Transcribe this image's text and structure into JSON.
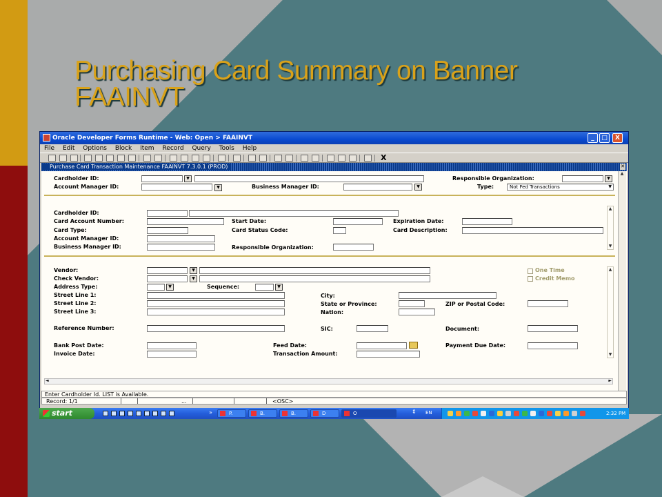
{
  "slide": {
    "title": "Purchasing Card Summary on Banner FAAINVT"
  },
  "window": {
    "title": "Oracle Developer Forms Runtime - Web:  Open > FAAINVT",
    "controls": [
      "_",
      "□",
      "X"
    ],
    "menu": [
      "File",
      "Edit",
      "Options",
      "Block",
      "Item",
      "Record",
      "Query",
      "Tools",
      "Help"
    ],
    "toolbar_exit": "X"
  },
  "form": {
    "header": "Purchase Card Transaction Maintenance  FAAINVT  7.3.0.1  (PROD)",
    "key_block": {
      "cardholder_id_label": "Cardholder ID:",
      "account_manager_id_label": "Account Manager ID:",
      "business_manager_id_label": "Business Manager ID:",
      "responsible_org_label": "Responsible Organization:",
      "type_label": "Type:",
      "type_value": "Not Fed Transactions"
    },
    "card_block": {
      "cardholder_id_label": "Cardholder ID:",
      "card_account_number_label": "Card Account Number:",
      "card_type_label": "Card Type:",
      "account_manager_id_label": "Account Manager ID:",
      "business_manager_id_label": "Business Manager ID:",
      "start_date_label": "Start Date:",
      "card_status_code_label": "Card Status Code:",
      "responsible_org_label": "Responsible Organization:",
      "expiration_date_label": "Expiration Date:",
      "card_description_label": "Card Description:"
    },
    "vendor_block": {
      "vendor_label": "Vendor:",
      "check_vendor_label": "Check Vendor:",
      "address_type_label": "Address Type:",
      "sequence_label": "Sequence:",
      "street1_label": "Street Line 1:",
      "street2_label": "Street Line 2:",
      "street3_label": "Street Line 3:",
      "city_label": "City:",
      "state_label": "State or Province:",
      "zip_label": "ZIP or Postal Code:",
      "nation_label": "Nation:",
      "one_time_label": "One Time",
      "credit_memo_label": "Credit Memo",
      "reference_number_label": "Reference Number:",
      "sic_label": "SIC:",
      "document_label": "Document:",
      "bank_post_date_label": "Bank Post Date:",
      "invoice_date_label": "Invoice Date:",
      "feed_date_label": "Feed Date:",
      "transaction_amount_label": "Transaction Amount:",
      "payment_due_date_label": "Payment Due Date:"
    }
  },
  "status": {
    "message": "Enter Cardholder Id. LIST is Available.",
    "record": "Record: 1/1",
    "ellipsis": "...",
    "mode": "<OSC>"
  },
  "taskbar": {
    "start_label": "start",
    "quicklaunch_more": "»",
    "tasks": [
      "P.",
      "B.",
      "B.",
      "D",
      "O"
    ],
    "language": "EN",
    "clock": "2:32 PM"
  }
}
